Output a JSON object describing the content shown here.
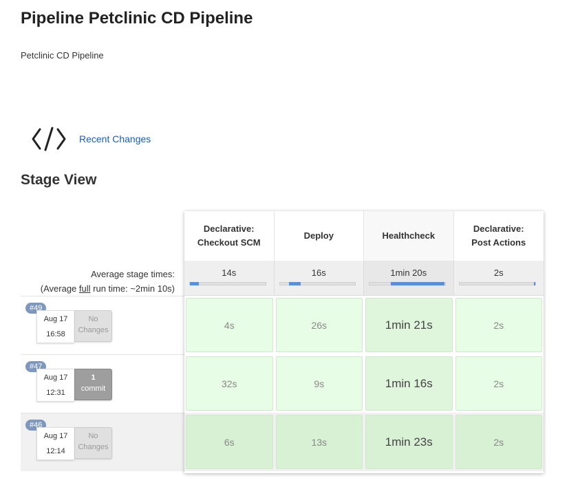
{
  "page": {
    "title": "Pipeline Petclinic CD Pipeline",
    "description": "Petclinic CD Pipeline"
  },
  "recent_changes": {
    "icon": "code-icon",
    "label": "Recent Changes"
  },
  "stage_view": {
    "title": "Stage View",
    "avg_times_label": "Average stage times:",
    "avg_full_prefix": "(Average ",
    "avg_full_word": "full",
    "avg_full_suffix": " run time: ~2min 10s)",
    "stages": [
      {
        "name_line1": "Declarative:",
        "name_line2": "Checkout SCM",
        "avg": "14s",
        "avg_fill_start": 0.0,
        "avg_fill_end": 0.12
      },
      {
        "name_line1": "Deploy",
        "name_line2": "",
        "avg": "16s",
        "avg_fill_start": 0.12,
        "avg_fill_end": 0.28
      },
      {
        "name_line1": "Healthcheck",
        "name_line2": "",
        "avg": "1min 20s",
        "avg_fill_start": 0.28,
        "avg_fill_end": 1.0
      },
      {
        "name_line1": "Declarative:",
        "name_line2": "Post Actions",
        "avg": "2s",
        "avg_fill_start": 0.98,
        "avg_fill_end": 1.0
      }
    ],
    "runs": [
      {
        "build": "#49",
        "date": "Aug 17",
        "time": "16:58",
        "changes_line1": "No",
        "changes_line2": "Changes",
        "durations": [
          "4s",
          "26s",
          "1min 21s",
          "2s"
        ]
      },
      {
        "build": "#47",
        "date": "Aug 17",
        "time": "12:31",
        "changes_line1": "1",
        "changes_line2": "commit",
        "durations": [
          "32s",
          "9s",
          "1min 16s",
          "2s"
        ]
      },
      {
        "build": "#46",
        "date": "Aug 17",
        "time": "12:14",
        "changes_line1": "No",
        "changes_line2": "Changes",
        "durations": [
          "6s",
          "13s",
          "1min 23s",
          "2s"
        ]
      }
    ]
  },
  "colors": {
    "link": "#1a5fb4",
    "success_cell": "#e7fde5",
    "badge": "#7e97bd",
    "progress": "#5b8fd8"
  }
}
